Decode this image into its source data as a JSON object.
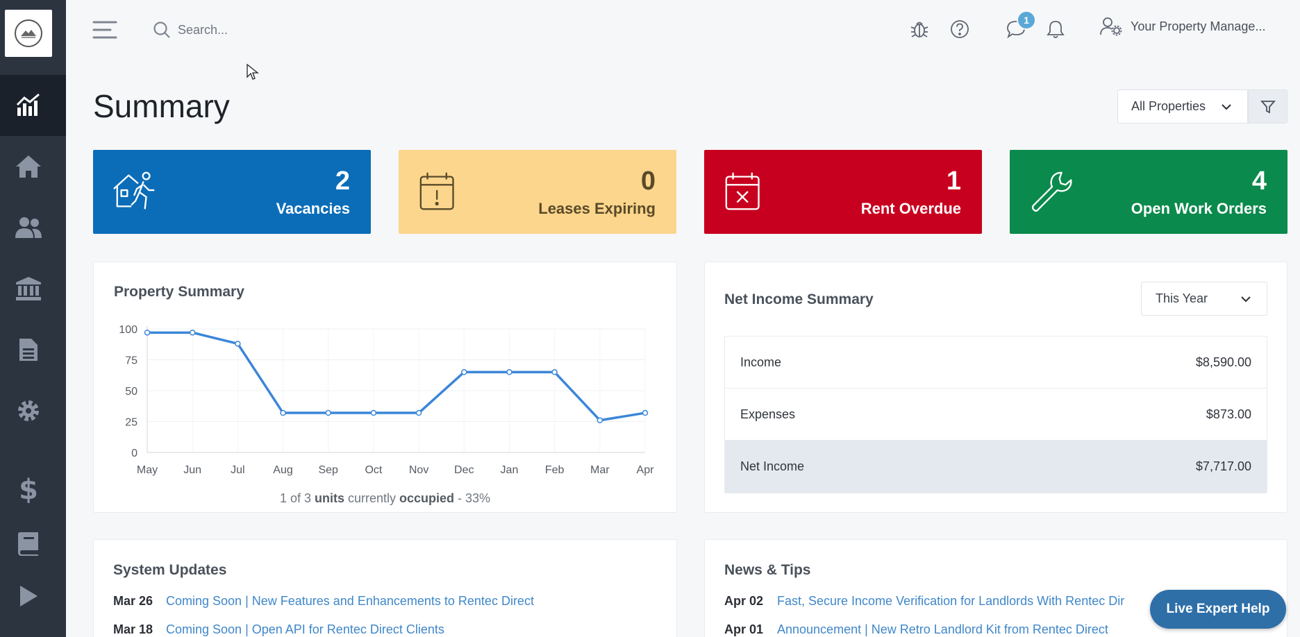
{
  "search": {
    "placeholder": "Search..."
  },
  "header": {
    "user_name": "Your Property Manage...",
    "messages_badge": "1"
  },
  "sidebar": {
    "items": [
      {
        "icon": "chart-icon",
        "active": true
      },
      {
        "icon": "home-icon"
      },
      {
        "icon": "users-icon"
      },
      {
        "icon": "bank-icon"
      },
      {
        "icon": "document-icon"
      },
      {
        "icon": "gear-icon"
      },
      {
        "icon": "dollar-icon"
      },
      {
        "icon": "book-icon"
      },
      {
        "icon": "play-icon"
      }
    ]
  },
  "page": {
    "title": "Summary",
    "property_filter": "All Properties"
  },
  "stats": [
    {
      "value": "2",
      "label": "Vacancies",
      "color": "#0b6db8"
    },
    {
      "value": "0",
      "label": "Leases Expiring",
      "color": "#fbd68c"
    },
    {
      "value": "1",
      "label": "Rent Overdue",
      "color": "#c8001f"
    },
    {
      "value": "4",
      "label": "Open Work Orders",
      "color": "#0a8a4c"
    }
  ],
  "property_summary": {
    "title": "Property Summary",
    "caption": {
      "a": "1 of 3 ",
      "b": "units",
      "c": " currently ",
      "d": "occupied",
      "e": " - 33%"
    }
  },
  "chart_data": {
    "type": "line",
    "categories": [
      "May",
      "Jun",
      "Jul",
      "Aug",
      "Sep",
      "Oct",
      "Nov",
      "Dec",
      "Jan",
      "Feb",
      "Mar",
      "Apr"
    ],
    "series": [
      {
        "values": [
          97,
          97,
          88,
          32,
          32,
          32,
          32,
          65,
          65,
          65,
          26,
          32
        ]
      }
    ],
    "ylim": [
      0,
      100
    ],
    "yticks": [
      0,
      25,
      50,
      75,
      100
    ],
    "grid": true,
    "color": "#3b86d9"
  },
  "net_income": {
    "title": "Net Income Summary",
    "period": "This Year",
    "rows": [
      {
        "label": "Income",
        "value": "$8,590.00"
      },
      {
        "label": "Expenses",
        "value": "$873.00"
      },
      {
        "label": "Net Income",
        "value": "$7,717.00"
      }
    ]
  },
  "system_updates": {
    "title": "System Updates",
    "items": [
      {
        "date": "Mar 26",
        "text": "Coming Soon | New Features and Enhancements to Rentec Direct"
      },
      {
        "date": "Mar 18",
        "text": "Coming Soon | Open API for Rentec Direct Clients"
      }
    ]
  },
  "news": {
    "title": "News & Tips",
    "items": [
      {
        "date": "Apr 02",
        "text": "Fast, Secure Income Verification for Landlords With Rentec Dir"
      },
      {
        "date": "Apr 01",
        "text": "Announcement | New Retro Landlord Kit from Rentec Direct"
      }
    ]
  },
  "live_help": {
    "label": "Live Expert Help"
  }
}
